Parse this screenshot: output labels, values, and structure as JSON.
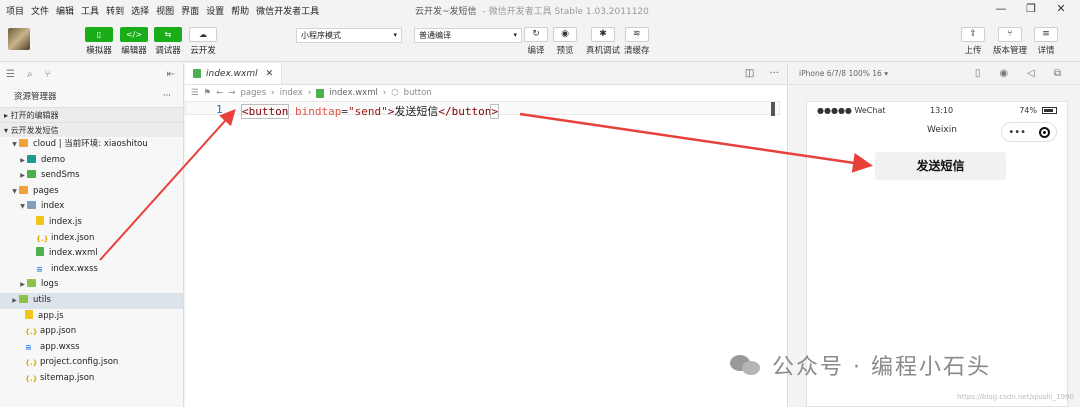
{
  "menu": [
    "项目",
    "文件",
    "编辑",
    "工具",
    "转到",
    "选择",
    "视图",
    "界面",
    "设置",
    "帮助",
    "微信开发者工具"
  ],
  "window": {
    "title": "云开发~发短信",
    "subtitle": "- 微信开发者工具 Stable 1.03.2011120"
  },
  "toolbar": {
    "simulator": "模拟器",
    "editor": "编辑器",
    "debugger": "调试器",
    "cloud": "云开发",
    "mode_select": "小程序模式",
    "compile_select": "普通编译",
    "compile": "编译",
    "preview": "预览",
    "real_debug": "真机调试",
    "clear_cache": "清缓存",
    "upload": "上传",
    "version": "版本管理",
    "details": "详情"
  },
  "sidebar": {
    "header": "资源管理器",
    "open_editors": "打开的编辑器",
    "project": "云开发发短信",
    "tree": [
      {
        "label": "cloud | 当前环境: xiaoshitou",
        "icon": "folder-orange"
      },
      {
        "label": "demo",
        "icon": "folder-teal"
      },
      {
        "label": "sendSms",
        "icon": "folder-green"
      },
      {
        "label": "pages",
        "icon": "folder-orange"
      },
      {
        "label": "index",
        "icon": "folder-blue"
      },
      {
        "label": "index.js",
        "icon": "js"
      },
      {
        "label": "index.json",
        "icon": "json"
      },
      {
        "label": "index.wxml",
        "icon": "wxml"
      },
      {
        "label": "index.wxss",
        "icon": "wxss"
      },
      {
        "label": "logs",
        "icon": "folder-olive"
      },
      {
        "label": "utils",
        "icon": "folder-olive"
      },
      {
        "label": "app.js",
        "icon": "js"
      },
      {
        "label": "app.json",
        "icon": "json"
      },
      {
        "label": "app.wxss",
        "icon": "wxss"
      },
      {
        "label": "project.config.json",
        "icon": "json"
      },
      {
        "label": "sitemap.json",
        "icon": "json"
      }
    ]
  },
  "editor": {
    "tab": "index.wxml",
    "crumbs": [
      "pages",
      "index",
      "index.wxml",
      "button"
    ],
    "line_number": "1",
    "code": {
      "open_tag": "<button",
      "attr": "bindtap",
      "eq": "=",
      "value": "\"send\"",
      "gt": ">",
      "text": "发送短信",
      "close_tag": "</button",
      "end": ">"
    }
  },
  "simulator": {
    "device": "iPhone 6/7/8 100% 16 ▾",
    "carrier": "●●●●● WeChat",
    "time": "13:10",
    "battery": "74%",
    "nav_title": "Weixin",
    "capsule_dots": "•••",
    "button_text": "发送短信"
  },
  "watermark": "公众号 · 编程小石头",
  "credit": "https://blog.csdn.net/qiushi_1990",
  "arrow_color": "#e8403a"
}
